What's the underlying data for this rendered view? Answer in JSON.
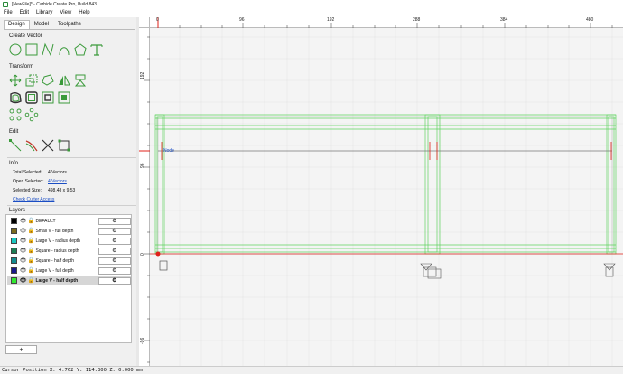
{
  "window": {
    "title": "[NewFile]* - Carbide Create Pro, Build 843"
  },
  "menu": [
    {
      "label": "File",
      "accel": "F"
    },
    {
      "label": "Edit",
      "accel": "E"
    },
    {
      "label": "Library",
      "accel": ""
    },
    {
      "label": "View",
      "accel": ""
    },
    {
      "label": "Help",
      "accel": "H"
    }
  ],
  "tabs": [
    "Design",
    "Model",
    "Toolpaths"
  ],
  "sections": {
    "create_vector": "Create Vector",
    "transform": "Transform",
    "edit": "Edit",
    "info": "Info",
    "layers": "Layers"
  },
  "create_tools": [
    "circle-tool-icon",
    "rectangle-tool-icon",
    "polyline-tool-icon",
    "curve-tool-icon",
    "polygon-tool-icon",
    "text-tool-icon"
  ],
  "info": {
    "total_selected_label": "Total Selected:",
    "total_selected_value": "4 Vectors",
    "open_selected_label": "Open Selected:",
    "open_selected_value": "4 Vectors",
    "selected_size_label": "Selected Size:",
    "selected_size_value": "498.48 x 9.53",
    "check_cutter_access": "Check Cutter Access"
  },
  "layers": [
    {
      "name": "DEFAULT",
      "color": "#000000",
      "selected": false
    },
    {
      "name": "Small V - full depth",
      "color": "#7a6a1e",
      "selected": false
    },
    {
      "name": "Large V - radius depth",
      "color": "#19c7c0",
      "selected": false
    },
    {
      "name": "Square - radius depth",
      "color": "#1d7d55",
      "selected": false
    },
    {
      "name": "Square - half depth",
      "color": "#138b8f",
      "selected": false
    },
    {
      "name": "Large V - full depth",
      "color": "#1a1a8a",
      "selected": false
    },
    {
      "name": "Large V - half depth",
      "color": "#2ee82e",
      "selected": true
    }
  ],
  "add_layer_label": "+",
  "rulers": {
    "top": [
      "0",
      "96",
      "192",
      "288",
      "384",
      "480"
    ],
    "left": [
      "192",
      "96",
      "0",
      "-96"
    ]
  },
  "canvas": {
    "node_label": "Node"
  },
  "status": {
    "cursor_position": "Cursor Position X: 4.762 Y: 114.300 Z: 0.000 mm"
  },
  "colors": {
    "vector_green": "#5fd35f",
    "grid": "#dcdcdc",
    "axis_red": "#e0201a",
    "selection_orange": "#e08a2a"
  }
}
